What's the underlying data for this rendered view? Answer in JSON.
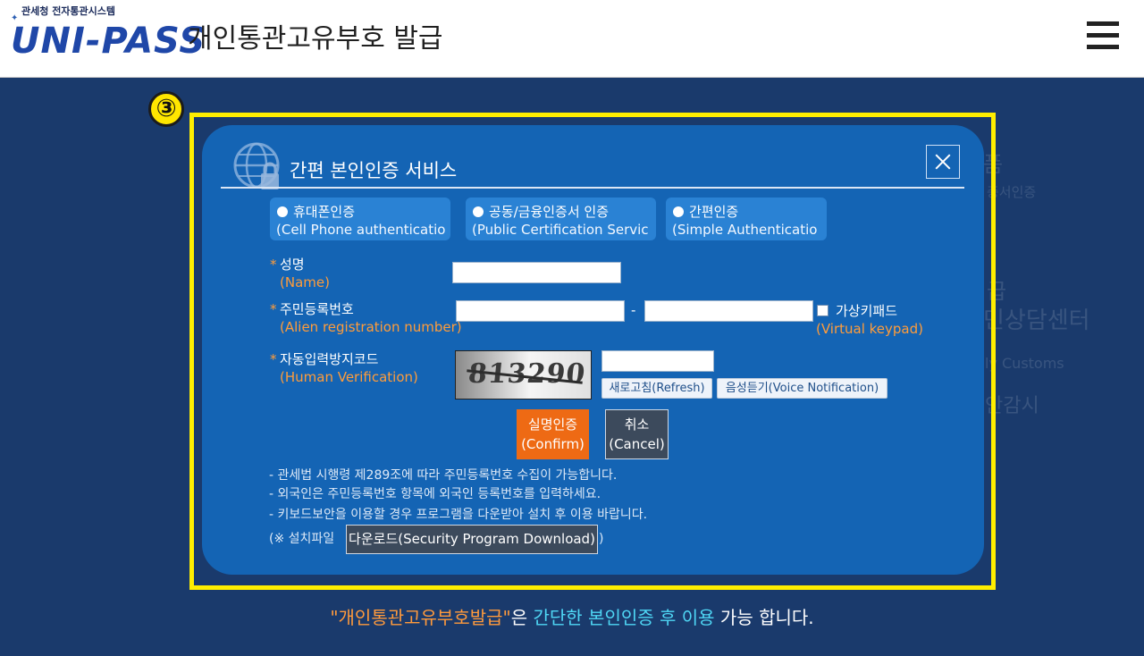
{
  "header": {
    "logo_sub": "관세청 전자통관시스템",
    "logo_main": "UNI-PASS",
    "title": "개인통관고유부호  발급",
    "menu_icon": "hamburger-menu-icon"
  },
  "background_text": [
    "품",
    "증서인증",
    "급",
    "민상담센터",
    "ly Customs",
    "안감시"
  ],
  "step_marker": "③",
  "modal": {
    "title": "간편 본인인증 서비스",
    "close_icon": "close-icon",
    "tabs": [
      {
        "label": "휴대폰인증",
        "sub": "(Cell Phone authenticatio"
      },
      {
        "label": "공동/금융인증서 인증",
        "sub": "(Public Certification Servic"
      },
      {
        "label": "간편인증",
        "sub": "(Simple Authenticatio"
      }
    ],
    "name_label": "성명",
    "name_label_en": "(Name)",
    "reg_label": "주민등록번호",
    "reg_label_en": "(Alien registration number)",
    "reg_separator": "-",
    "vkeypad_label": "가상키패드",
    "vkeypad_label_en": "(Virtual keypad)",
    "captcha_label": "자동입력방지코드",
    "captcha_label_en": "(Human Verification)",
    "captcha_text": "813290",
    "refresh_button": "새로고침(Refresh)",
    "voice_button": "음성듣기(Voice Notification)",
    "confirm_button": [
      "실명인증",
      "(Confirm)"
    ],
    "cancel_button": [
      "취소",
      "(Cancel)"
    ],
    "notes": [
      "- 관세법 시행령 제289조에 따라 주민등록번호 수집이 가능합니다.",
      "- 외국인은 주민등록번호 항목에 외국인 등록번호를 입력하세요.",
      "- 키보드보안을 이용할 경우 프로그램을 다운받아 설치 후 이용 바랍니다."
    ],
    "install_prefix": "(※ 설치파일",
    "download_button": "다운로드(Security Program Download)",
    "install_suffix": ")"
  },
  "footer_caption": {
    "part1": "\"개인통관고유부호발급\"",
    "part2": "은 ",
    "part3": "간단한 본인인증 후 이용",
    "part4": " 가능 합니다."
  },
  "colors": {
    "background": "#1a3a6c",
    "modal": "#1464b4",
    "highlight_frame": "#ffee00",
    "label_orange": "#ff9c3a",
    "confirm": "#ee6a14",
    "caption_cyan": "#4fd7f5"
  }
}
